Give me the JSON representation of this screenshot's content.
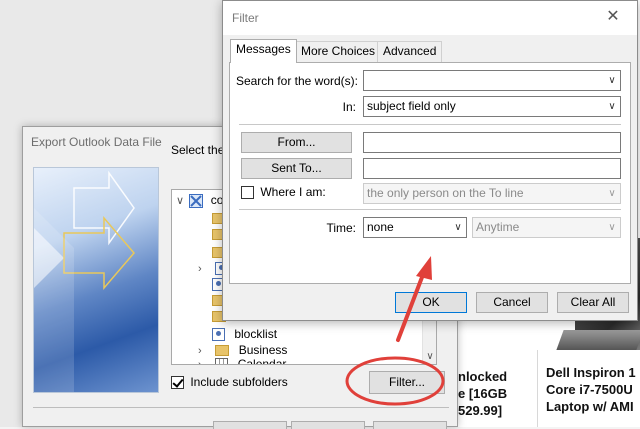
{
  "background": {
    "product_left": [
      "nlocked",
      "e [16GB",
      "529.99]"
    ],
    "product_right": [
      "Dell Inspiron 1",
      "Core i7-7500U",
      "Laptop w/ AMI"
    ]
  },
  "export_dialog": {
    "title": "Export Outlook Data File",
    "select_label": "Select the",
    "tree_items": [
      {
        "label": "co",
        "icon": "mailbox-icon"
      },
      {
        "label": "",
        "icon": "folder-icon"
      },
      {
        "label": "",
        "icon": "folder-icon"
      },
      {
        "label": "",
        "icon": "folder-icon"
      },
      {
        "label": "",
        "icon": "contacts-icon"
      },
      {
        "label": "",
        "icon": "folder-icon"
      },
      {
        "label": "",
        "icon": "folder-icon"
      },
      {
        "label": "blocklist",
        "icon": "contacts-icon"
      },
      {
        "label": "Business",
        "icon": "folder-icon"
      },
      {
        "label": "Calendar",
        "icon": "calendar-icon"
      }
    ],
    "include_subfolders": "Include subfolders",
    "filter_button": "Filter..."
  },
  "filter_dialog": {
    "title": "Filter",
    "tabs": [
      "Messages",
      "More Choices",
      "Advanced"
    ],
    "search_label": "Search for the word(s):",
    "search_value": "",
    "in_label": "In:",
    "in_value": "subject field only",
    "from_button": "From...",
    "from_value": "",
    "sent_to_button": "Sent To...",
    "sent_to_value": "",
    "where_label": "Where I am:",
    "where_value": "the only person on the To line",
    "time_label": "Time:",
    "time_value": "none",
    "time_range_value": "Anytime",
    "ok_button": "OK",
    "cancel_button": "Cancel",
    "clear_button": "Clear All"
  },
  "colors": {
    "annotation": "#e0403a",
    "accent": "#0078d7"
  }
}
